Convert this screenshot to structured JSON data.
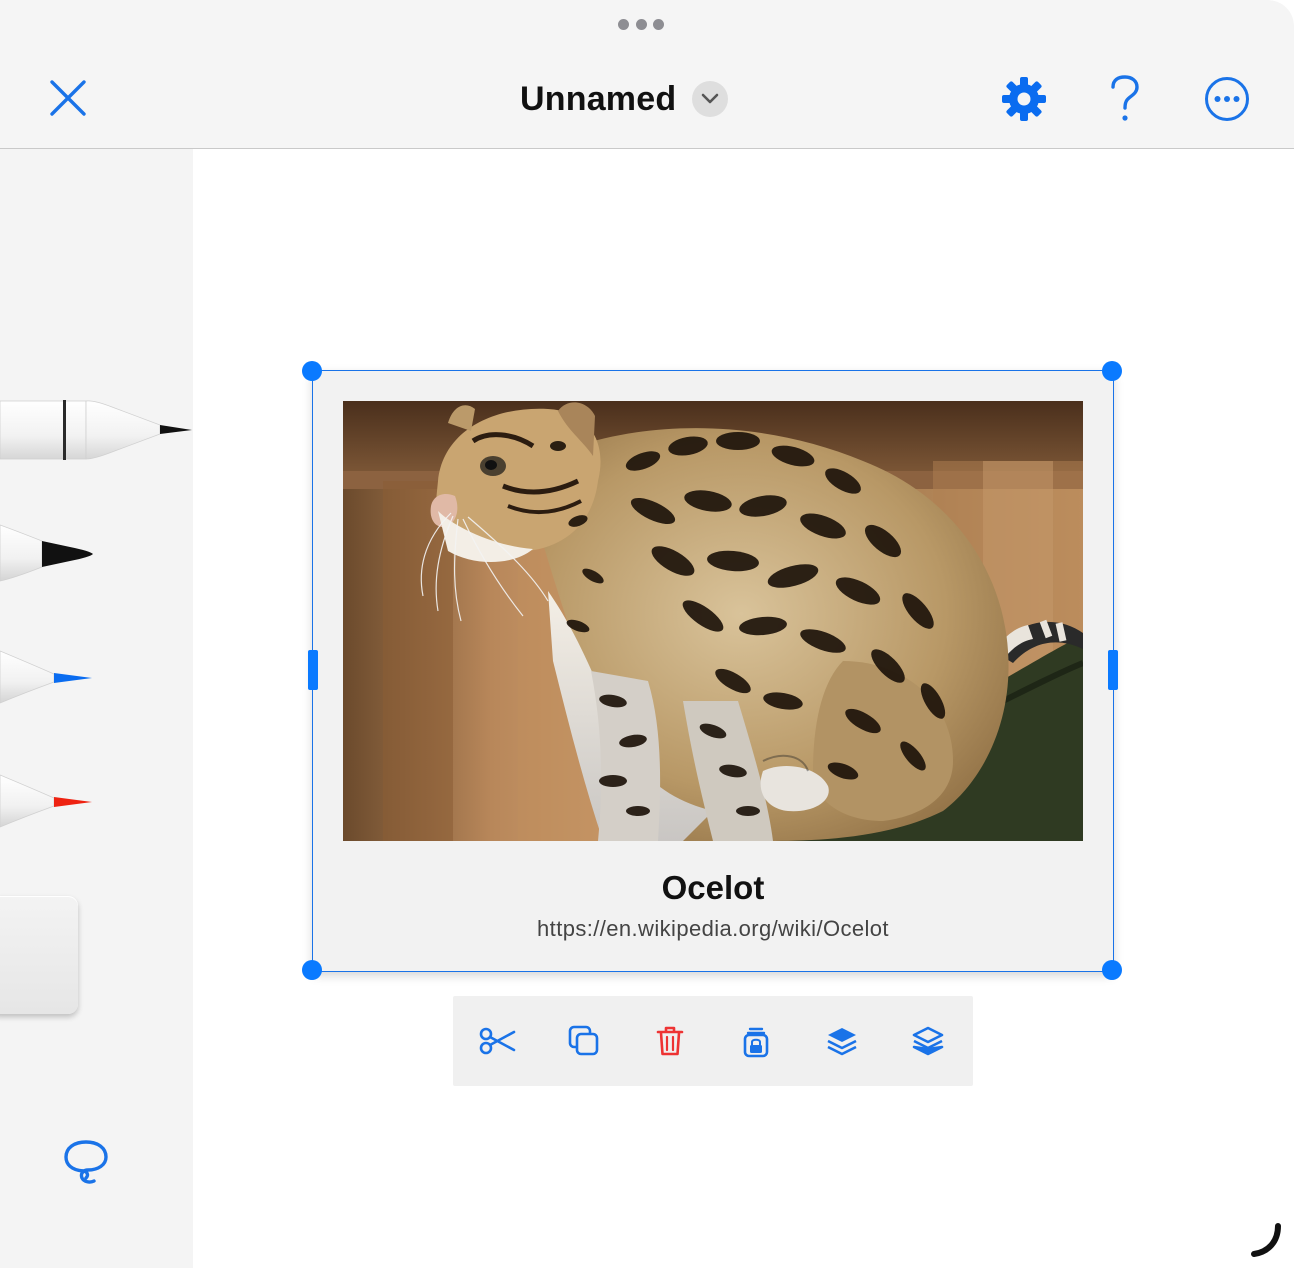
{
  "header": {
    "title": "Unnamed",
    "icons": {
      "close": "close-icon",
      "title_menu": "chevron-down-icon",
      "settings": "gear-icon",
      "help": "question-mark-icon",
      "more": "ellipsis-circle-icon",
      "grabber": "window-grabber-icon"
    }
  },
  "palette": {
    "tools": [
      {
        "name": "fineliner-black",
        "color": "#111111"
      },
      {
        "name": "marker-black",
        "color": "#111111"
      },
      {
        "name": "pen-blue",
        "color": "#0a6cf0"
      },
      {
        "name": "pen-red",
        "color": "#ee2211"
      },
      {
        "name": "eraser",
        "color": "#e8e8e8"
      },
      {
        "name": "lasso",
        "color": "#1a73e8"
      }
    ]
  },
  "card": {
    "title": "Ocelot",
    "url": "https://en.wikipedia.org/wiki/Ocelot",
    "image": "ocelot-photo"
  },
  "context_toolbar": {
    "items": [
      {
        "name": "cut",
        "icon": "scissors-icon",
        "color": "#1a73e8"
      },
      {
        "name": "duplicate",
        "icon": "copy-icon",
        "color": "#1a73e8"
      },
      {
        "name": "delete",
        "icon": "trash-icon",
        "color": "#ee3333"
      },
      {
        "name": "lock",
        "icon": "lock-icon",
        "color": "#1a73e8"
      },
      {
        "name": "bring-forward",
        "icon": "layers-up-icon",
        "color": "#1a73e8"
      },
      {
        "name": "send-backward",
        "icon": "layers-down-icon",
        "color": "#1a73e8"
      }
    ]
  },
  "colors": {
    "accent": "#0a7aff",
    "header_bg": "#f5f5f5",
    "palette_bg": "#f4f4f4",
    "delete_red": "#ee3333"
  }
}
